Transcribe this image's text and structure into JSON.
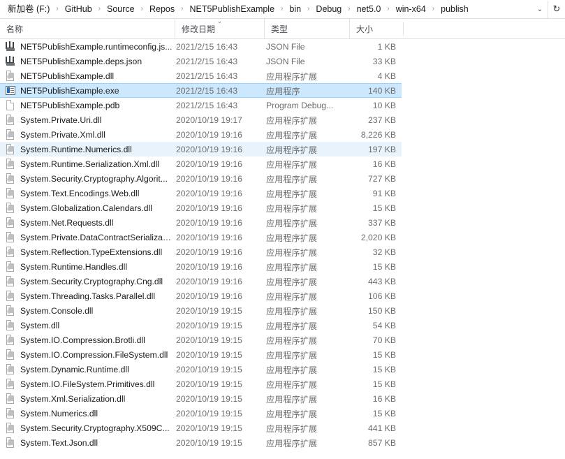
{
  "address_bar": {
    "breadcrumbs": [
      "新加卷 (F:)",
      "GitHub",
      "Source",
      "Repos",
      "NET5PublishExample",
      "bin",
      "Debug",
      "net5.0",
      "win-x64",
      "publish"
    ],
    "separator": "›",
    "dropdown_icon": "chevron-down-icon",
    "dropdown_glyph": "⌄",
    "refresh_icon": "refresh-icon",
    "refresh_glyph": "↻"
  },
  "columns": {
    "name": "名称",
    "date_modified": "修改日期",
    "type": "类型",
    "size": "大小",
    "sort_indicator": "⌄",
    "sorted_by": "修改日期",
    "sort_direction": "descending"
  },
  "colors": {
    "selection_fill": "#cce8ff",
    "selection_border": "#99d1ff",
    "hover_fill": "#e8f3fc",
    "text_primary": "#1b1b1b",
    "text_secondary": "#6d6d6d",
    "divider": "#e2e2e2"
  },
  "files": [
    {
      "name": "NET5PublishExample.runtimeconfig.js...",
      "date": "2021/2/15 16:43",
      "type": "JSON File",
      "size": "1 KB",
      "icon": "json",
      "state": "normal"
    },
    {
      "name": "NET5PublishExample.deps.json",
      "date": "2021/2/15 16:43",
      "type": "JSON File",
      "size": "33 KB",
      "icon": "json",
      "state": "normal"
    },
    {
      "name": "NET5PublishExample.dll",
      "date": "2021/2/15 16:43",
      "type": "应用程序扩展",
      "size": "4 KB",
      "icon": "dll",
      "state": "normal"
    },
    {
      "name": "NET5PublishExample.exe",
      "date": "2021/2/15 16:43",
      "type": "应用程序",
      "size": "140 KB",
      "icon": "exe",
      "state": "selected"
    },
    {
      "name": "NET5PublishExample.pdb",
      "date": "2021/2/15 16:43",
      "type": "Program Debug...",
      "size": "10 KB",
      "icon": "blank",
      "state": "normal"
    },
    {
      "name": "System.Private.Uri.dll",
      "date": "2020/10/19 19:17",
      "type": "应用程序扩展",
      "size": "237 KB",
      "icon": "dll",
      "state": "normal"
    },
    {
      "name": "System.Private.Xml.dll",
      "date": "2020/10/19 19:16",
      "type": "应用程序扩展",
      "size": "8,226 KB",
      "icon": "dll",
      "state": "normal"
    },
    {
      "name": "System.Runtime.Numerics.dll",
      "date": "2020/10/19 19:16",
      "type": "应用程序扩展",
      "size": "197 KB",
      "icon": "dll",
      "state": "hover"
    },
    {
      "name": "System.Runtime.Serialization.Xml.dll",
      "date": "2020/10/19 19:16",
      "type": "应用程序扩展",
      "size": "16 KB",
      "icon": "dll",
      "state": "normal"
    },
    {
      "name": "System.Security.Cryptography.Algorit...",
      "date": "2020/10/19 19:16",
      "type": "应用程序扩展",
      "size": "727 KB",
      "icon": "dll",
      "state": "normal"
    },
    {
      "name": "System.Text.Encodings.Web.dll",
      "date": "2020/10/19 19:16",
      "type": "应用程序扩展",
      "size": "91 KB",
      "icon": "dll",
      "state": "normal"
    },
    {
      "name": "System.Globalization.Calendars.dll",
      "date": "2020/10/19 19:16",
      "type": "应用程序扩展",
      "size": "15 KB",
      "icon": "dll",
      "state": "normal"
    },
    {
      "name": "System.Net.Requests.dll",
      "date": "2020/10/19 19:16",
      "type": "应用程序扩展",
      "size": "337 KB",
      "icon": "dll",
      "state": "normal"
    },
    {
      "name": "System.Private.DataContractSerializati...",
      "date": "2020/10/19 19:16",
      "type": "应用程序扩展",
      "size": "2,020 KB",
      "icon": "dll",
      "state": "normal"
    },
    {
      "name": "System.Reflection.TypeExtensions.dll",
      "date": "2020/10/19 19:16",
      "type": "应用程序扩展",
      "size": "32 KB",
      "icon": "dll",
      "state": "normal"
    },
    {
      "name": "System.Runtime.Handles.dll",
      "date": "2020/10/19 19:16",
      "type": "应用程序扩展",
      "size": "15 KB",
      "icon": "dll",
      "state": "normal"
    },
    {
      "name": "System.Security.Cryptography.Cng.dll",
      "date": "2020/10/19 19:16",
      "type": "应用程序扩展",
      "size": "443 KB",
      "icon": "dll",
      "state": "normal"
    },
    {
      "name": "System.Threading.Tasks.Parallel.dll",
      "date": "2020/10/19 19:16",
      "type": "应用程序扩展",
      "size": "106 KB",
      "icon": "dll",
      "state": "normal"
    },
    {
      "name": "System.Console.dll",
      "date": "2020/10/19 19:15",
      "type": "应用程序扩展",
      "size": "150 KB",
      "icon": "dll",
      "state": "normal"
    },
    {
      "name": "System.dll",
      "date": "2020/10/19 19:15",
      "type": "应用程序扩展",
      "size": "54 KB",
      "icon": "dll",
      "state": "normal"
    },
    {
      "name": "System.IO.Compression.Brotli.dll",
      "date": "2020/10/19 19:15",
      "type": "应用程序扩展",
      "size": "70 KB",
      "icon": "dll",
      "state": "normal"
    },
    {
      "name": "System.IO.Compression.FileSystem.dll",
      "date": "2020/10/19 19:15",
      "type": "应用程序扩展",
      "size": "15 KB",
      "icon": "dll",
      "state": "normal"
    },
    {
      "name": "System.Dynamic.Runtime.dll",
      "date": "2020/10/19 19:15",
      "type": "应用程序扩展",
      "size": "15 KB",
      "icon": "dll",
      "state": "normal"
    },
    {
      "name": "System.IO.FileSystem.Primitives.dll",
      "date": "2020/10/19 19:15",
      "type": "应用程序扩展",
      "size": "15 KB",
      "icon": "dll",
      "state": "normal"
    },
    {
      "name": "System.Xml.Serialization.dll",
      "date": "2020/10/19 19:15",
      "type": "应用程序扩展",
      "size": "16 KB",
      "icon": "dll",
      "state": "normal"
    },
    {
      "name": "System.Numerics.dll",
      "date": "2020/10/19 19:15",
      "type": "应用程序扩展",
      "size": "15 KB",
      "icon": "dll",
      "state": "normal"
    },
    {
      "name": "System.Security.Cryptography.X509C...",
      "date": "2020/10/19 19:15",
      "type": "应用程序扩展",
      "size": "441 KB",
      "icon": "dll",
      "state": "normal"
    },
    {
      "name": "System.Text.Json.dll",
      "date": "2020/10/19 19:15",
      "type": "应用程序扩展",
      "size": "857 KB",
      "icon": "dll",
      "state": "normal"
    }
  ]
}
